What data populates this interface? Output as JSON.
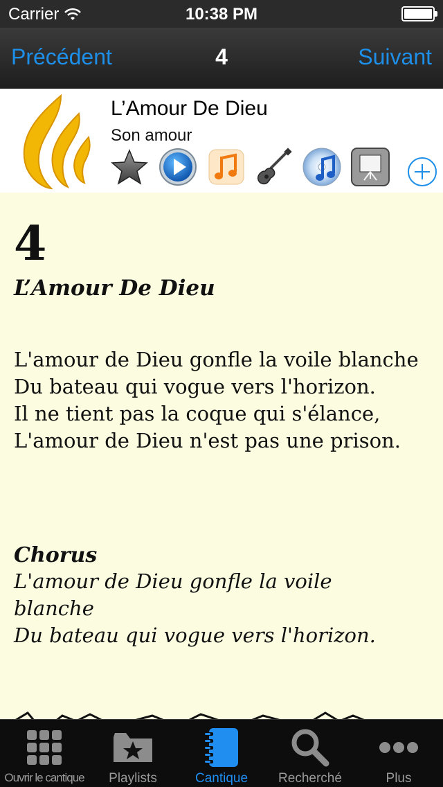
{
  "status": {
    "carrier": "Carrier",
    "time": "10:38 PM"
  },
  "nav": {
    "prev_label": "Précédent",
    "title": "4",
    "next_label": "Suivant"
  },
  "header": {
    "title": "L’Amour De Dieu",
    "subtitle": "Son amour",
    "icons": [
      "star-icon",
      "play-icon",
      "music-note-icon",
      "guitar-icon",
      "itunes-icon",
      "presentation-icon",
      "add-icon"
    ]
  },
  "hymn": {
    "number": "4",
    "title": "L’Amour De Dieu",
    "verse_lines": [
      "L'amour de Dieu gonfle la voile blanche",
      "Du bateau qui vogue vers l'horizon.",
      "Il ne tient pas la coque qui s'élance,",
      "L'amour de Dieu n'est pas une prison."
    ],
    "chorus_label": "Chorus",
    "chorus_lines": [
      "L'amour de Dieu gonfle la voile blanche",
      "Du bateau qui vogue vers l'horizon."
    ]
  },
  "tabs": [
    {
      "label": "Ouvrir le cantique",
      "icon": "grid-icon"
    },
    {
      "label": "Playlists",
      "icon": "folder-star-icon"
    },
    {
      "label": "Cantique",
      "icon": "notebook-icon",
      "active": true
    },
    {
      "label": "Recherché",
      "icon": "magnifier-icon"
    },
    {
      "label": "Plus",
      "icon": "more-icon"
    }
  ],
  "colors": {
    "accent": "#1e8fe8",
    "content_bg": "#fbfce0",
    "logo_gold": "#f2b705"
  }
}
